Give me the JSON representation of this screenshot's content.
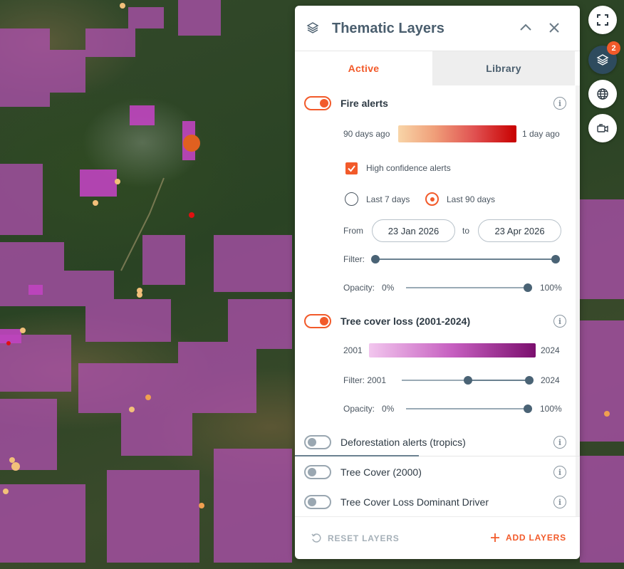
{
  "panel": {
    "title": "Thematic Layers",
    "tabs": [
      {
        "label": "Active"
      },
      {
        "label": "Library"
      }
    ]
  },
  "layers": {
    "fire_alerts": {
      "name": "Fire alerts",
      "enabled": true,
      "legend_start": "90 days ago",
      "legend_end": "1 day ago",
      "high_confidence_label": "High confidence alerts",
      "high_confidence_checked": true,
      "range_options": [
        "Last 7 days",
        "Last 90 days"
      ],
      "selected_range": "Last 90 days",
      "from_label": "From",
      "to_label": "to",
      "from_date": "23 Jan 2026",
      "to_date": "23 Apr 2026",
      "filter_label": "Filter:",
      "opacity_label": "Opacity:",
      "opacity_min": "0%",
      "opacity_max": "100%",
      "opacity_value": 100
    },
    "tree_cover_loss": {
      "name": "Tree cover loss (2001-2024)",
      "enabled": true,
      "legend_start": "2001",
      "legend_end": "2024",
      "filter_label": "Filter: 2001",
      "filter_max": "2024",
      "filter_low_fraction": 0.52,
      "opacity_label": "Opacity:",
      "opacity_min": "0%",
      "opacity_max": "100%",
      "opacity_value": 100
    },
    "inactive": [
      {
        "name": "Deforestation alerts (tropics)",
        "enabled": false
      },
      {
        "name": "Tree Cover (2000)",
        "enabled": false
      },
      {
        "name": "Tree Cover Loss Dominant Driver",
        "enabled": false
      }
    ]
  },
  "footer": {
    "reset_label": "RESET LAYERS",
    "add_label": "ADD LAYERS"
  },
  "toolbar": {
    "layers_badge": "2"
  },
  "colors": {
    "accent": "#f25a2a",
    "slate": "#4a5e6e",
    "fire_gradient": [
      "#f8d5a8",
      "#c80000"
    ],
    "loss_gradient": [
      "#f2c6ee",
      "#7b0f6e"
    ]
  }
}
